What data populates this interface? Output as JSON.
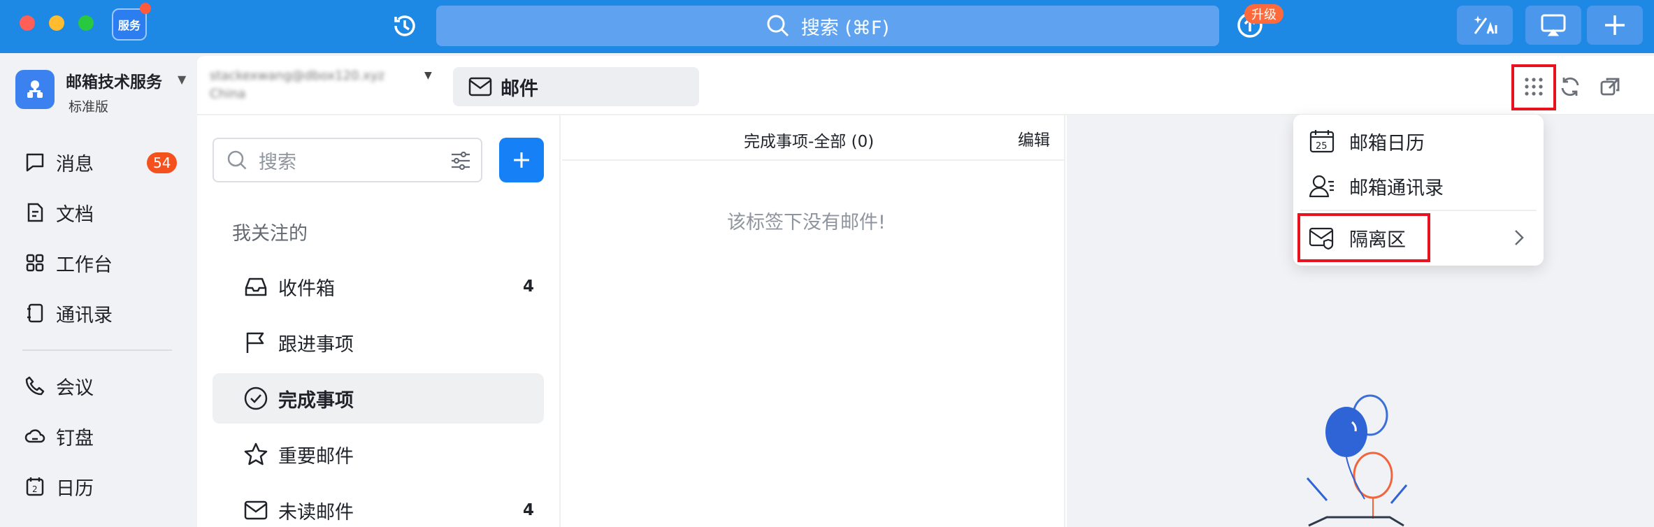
{
  "titlebar": {
    "app_badge": "服务",
    "search_label": "搜索 (⌘F)",
    "upgrade_badge": "升级",
    "icons": [
      "history-icon",
      "search-icon",
      "upgrade-icon",
      "ai-icon",
      "screen-share-icon",
      "plus-icon"
    ]
  },
  "org": {
    "name": "邮箱技术服务",
    "plan": "标准版"
  },
  "nav": {
    "items": [
      {
        "label": "消息",
        "badge": "54"
      },
      {
        "label": "文档"
      },
      {
        "label": "工作台"
      },
      {
        "label": "通讯录"
      },
      {
        "label": "会议"
      },
      {
        "label": "钉盘"
      },
      {
        "label": "日历"
      }
    ]
  },
  "header": {
    "account_line1": "stackexwang@dbox120.xyz",
    "account_line2": "China",
    "tab_label": "邮件"
  },
  "folders": {
    "search_placeholder": "搜索",
    "section_title": "我关注的",
    "items": [
      {
        "label": "收件箱",
        "count": "4"
      },
      {
        "label": "跟进事项"
      },
      {
        "label": "完成事项",
        "active": true
      },
      {
        "label": "重要邮件"
      },
      {
        "label": "未读邮件",
        "count": "4"
      }
    ]
  },
  "list": {
    "title": "完成事项-全部 (0)",
    "edit_label": "编辑",
    "empty_text": "该标签下没有邮件!"
  },
  "dropdown": {
    "items": [
      {
        "label": "邮箱日历",
        "icon": "calendar-icon",
        "calendar_day": "25"
      },
      {
        "label": "邮箱通讯录",
        "icon": "contacts-icon"
      },
      {
        "label": "隔离区",
        "icon": "quarantine-icon"
      }
    ]
  },
  "colors": {
    "brand": "#1e88e5",
    "highlight": "#e8131f",
    "badge": "#f5511e",
    "primary_button": "#1681f7"
  }
}
